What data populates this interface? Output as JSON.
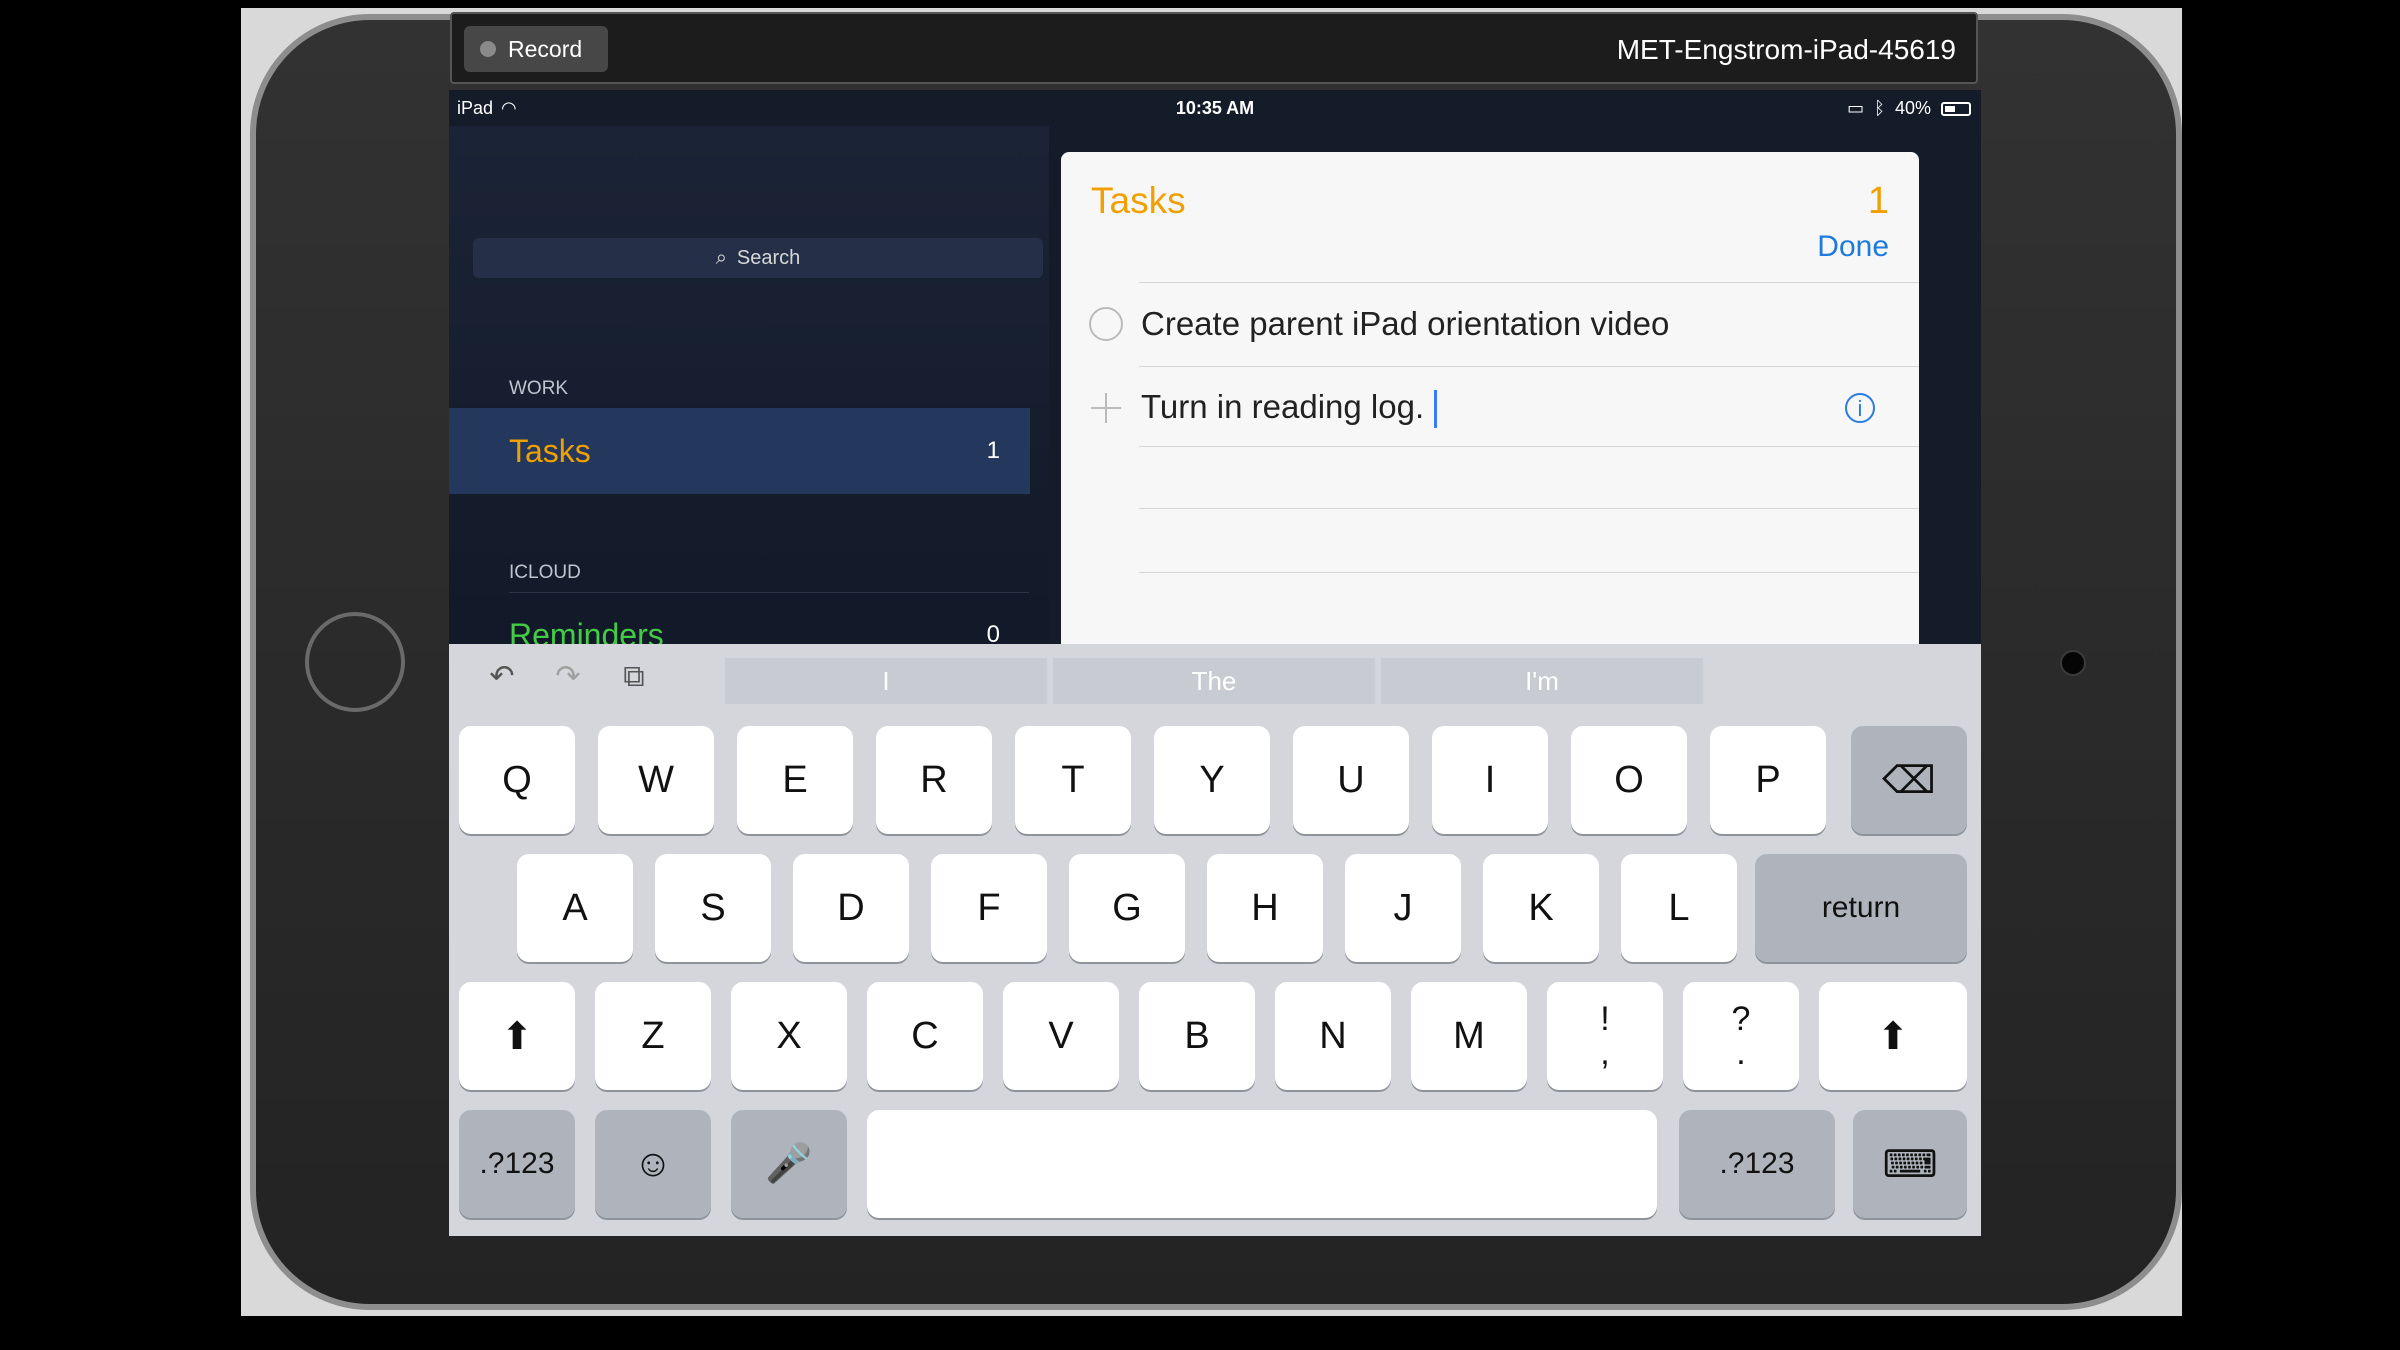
{
  "recording": {
    "button_label": "Record",
    "device_name": "MET-Engstrom-iPad-45619"
  },
  "status_bar": {
    "left": "iPad",
    "time": "10:35 AM",
    "battery": "40%"
  },
  "sidebar": {
    "search_placeholder": "Search",
    "groups": [
      {
        "label": "WORK",
        "items": [
          {
            "name": "Tasks",
            "count": "1"
          }
        ]
      },
      {
        "label": "ICLOUD",
        "items": [
          {
            "name": "Reminders",
            "count": "0"
          }
        ]
      }
    ]
  },
  "task_panel": {
    "title": "Tasks",
    "count": "1",
    "done_label": "Done",
    "tasks": [
      {
        "text": "Create parent iPad orientation video"
      },
      {
        "text": "Turn in reading log."
      }
    ]
  },
  "keyboard": {
    "suggestions": [
      "I",
      "The",
      "I'm"
    ],
    "row1": [
      "Q",
      "W",
      "E",
      "R",
      "T",
      "Y",
      "U",
      "I",
      "O",
      "P"
    ],
    "row2": [
      "A",
      "S",
      "D",
      "F",
      "G",
      "H",
      "J",
      "K",
      "L"
    ],
    "row3": [
      "Z",
      "X",
      "C",
      "V",
      "B",
      "N",
      "M"
    ],
    "return_label": "return",
    "numbers_label": ".?123",
    "punct_1": {
      "top": "!",
      "bottom": ","
    },
    "punct_2": {
      "top": "?",
      "bottom": "."
    },
    "icons": {
      "undo": "undo-icon",
      "redo": "redo-icon",
      "paste": "paste-icon",
      "backspace": "backspace-icon",
      "shift": "shift-icon",
      "emoji": "emoji-icon",
      "mic": "microphone-icon",
      "hide": "keyboard-hide-icon"
    }
  },
  "colors": {
    "accent_orange": "#f0a000",
    "accent_green": "#44cc44",
    "accent_blue": "#1f7ae0"
  }
}
